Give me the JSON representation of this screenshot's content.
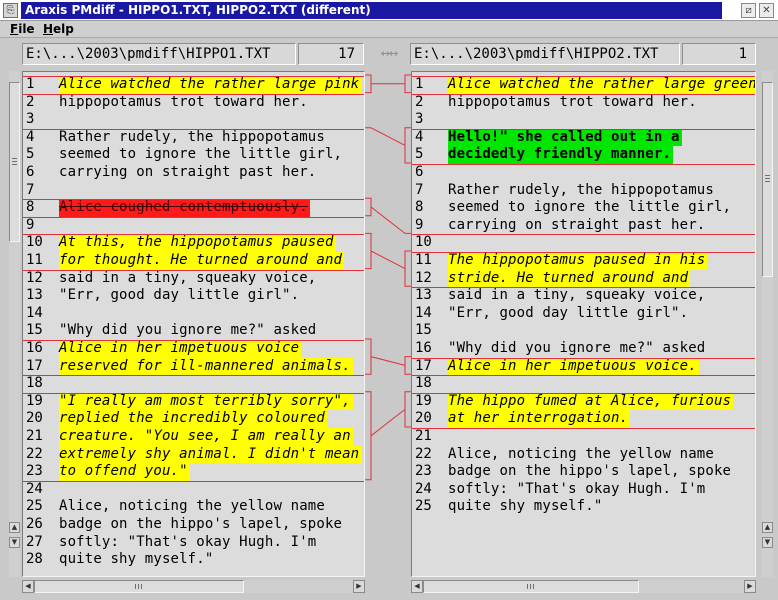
{
  "window": {
    "title": "Araxis PMdiff - HIPPO1.TXT, HIPPO2.TXT (different)",
    "app_icon": "app-icon",
    "buttons": [
      "minimize-icon",
      "close-icon"
    ]
  },
  "menu": [
    {
      "label": "File",
      "mnemonic": "F"
    },
    {
      "label": "Help",
      "mnemonic": "H"
    }
  ],
  "left": {
    "path": "E:\\...\\2003\\pmdiff\\HIPPO1.TXT",
    "count": "17",
    "lines": [
      {
        "n": "1",
        "text": "Alice watched the rather large pink",
        "kind": "changed"
      },
      {
        "n": "2",
        "text": "hippopotamus trot toward her.",
        "kind": "same"
      },
      {
        "n": "3",
        "text": "",
        "kind": "same"
      },
      {
        "n": "4",
        "text": "Rather rudely, the hippopotamus",
        "kind": "same"
      },
      {
        "n": "5",
        "text": "seemed to ignore the little girl,",
        "kind": "same"
      },
      {
        "n": "6",
        "text": "carrying on straight past her.",
        "kind": "same"
      },
      {
        "n": "7",
        "text": "",
        "kind": "same"
      },
      {
        "n": "8",
        "text": "Alice coughed contemptuously.",
        "kind": "deleted"
      },
      {
        "n": "9",
        "text": "",
        "kind": "same"
      },
      {
        "n": "10",
        "text": "At this, the hippopotamus paused",
        "kind": "changed"
      },
      {
        "n": "11",
        "text": "for thought. He turned around and",
        "kind": "changed"
      },
      {
        "n": "12",
        "text": "said in a tiny, squeaky voice,",
        "kind": "same"
      },
      {
        "n": "13",
        "text": "\"Err, good day little girl\".",
        "kind": "same"
      },
      {
        "n": "14",
        "text": "",
        "kind": "same"
      },
      {
        "n": "15",
        "text": "\"Why did you ignore me?\" asked",
        "kind": "same"
      },
      {
        "n": "16",
        "text": "Alice in her impetuous voice",
        "kind": "changed"
      },
      {
        "n": "17",
        "text": "reserved for ill-mannered animals.",
        "kind": "changed"
      },
      {
        "n": "18",
        "text": "",
        "kind": "same"
      },
      {
        "n": "19",
        "text": "\"I really am most terribly sorry\",",
        "kind": "changed"
      },
      {
        "n": "20",
        "text": "replied the incredibly coloured",
        "kind": "changed"
      },
      {
        "n": "21",
        "text": "creature. \"You see, I am really an",
        "kind": "changed"
      },
      {
        "n": "22",
        "text": "extremely shy animal. I didn't mean",
        "kind": "changed"
      },
      {
        "n": "23",
        "text": "to offend you.\"",
        "kind": "changed"
      },
      {
        "n": "24",
        "text": "",
        "kind": "same"
      },
      {
        "n": "25",
        "text": "Alice, noticing the yellow name",
        "kind": "same"
      },
      {
        "n": "26",
        "text": "badge on the hippo's lapel, spoke",
        "kind": "same"
      },
      {
        "n": "27",
        "text": "softly: \"That's okay Hugh. I'm",
        "kind": "same"
      },
      {
        "n": "28",
        "text": "quite shy myself.\"",
        "kind": "same"
      }
    ]
  },
  "right": {
    "path": "E:\\...\\2003\\pmdiff\\HIPPO2.TXT",
    "count": "1",
    "lines": [
      {
        "n": "1",
        "text": "Alice watched the rather large green",
        "kind": "changed"
      },
      {
        "n": "2",
        "text": "hippopotamus trot toward her.",
        "kind": "same"
      },
      {
        "n": "3",
        "text": "",
        "kind": "same"
      },
      {
        "n": "4",
        "text": "Hello!\" she called out in a",
        "kind": "inserted"
      },
      {
        "n": "5",
        "text": "decidedly friendly manner.",
        "kind": "inserted"
      },
      {
        "n": "6",
        "text": "",
        "kind": "same"
      },
      {
        "n": "7",
        "text": "Rather rudely, the hippopotamus",
        "kind": "same"
      },
      {
        "n": "8",
        "text": "seemed to ignore the little girl,",
        "kind": "same"
      },
      {
        "n": "9",
        "text": "carrying on straight past her.",
        "kind": "same"
      },
      {
        "n": "10",
        "text": "",
        "kind": "same"
      },
      {
        "n": "11",
        "text": "The hippopotamus paused in his",
        "kind": "changed"
      },
      {
        "n": "12",
        "text": "stride. He turned around and",
        "kind": "changed"
      },
      {
        "n": "13",
        "text": "said in a tiny, squeaky voice,",
        "kind": "same"
      },
      {
        "n": "14",
        "text": "\"Err, good day little girl\".",
        "kind": "same"
      },
      {
        "n": "15",
        "text": "",
        "kind": "same"
      },
      {
        "n": "16",
        "text": "\"Why did you ignore me?\" asked",
        "kind": "same"
      },
      {
        "n": "17",
        "text": "Alice in her impetuous voice.",
        "kind": "changed"
      },
      {
        "n": "18",
        "text": "",
        "kind": "same"
      },
      {
        "n": "19",
        "text": "The hippo fumed at Alice, furious",
        "kind": "changed"
      },
      {
        "n": "20",
        "text": "at her interrogation.",
        "kind": "changed"
      },
      {
        "n": "21",
        "text": "",
        "kind": "same"
      },
      {
        "n": "22",
        "text": "Alice, noticing the yellow name",
        "kind": "same"
      },
      {
        "n": "23",
        "text": "badge on the hippo's lapel, spoke",
        "kind": "same"
      },
      {
        "n": "24",
        "text": "softly: \"That's okay Hugh. I'm",
        "kind": "same"
      },
      {
        "n": "25",
        "text": "quite shy myself.\"",
        "kind": "same"
      }
    ]
  },
  "links": [
    {
      "l": [
        1,
        1
      ],
      "r": [
        1,
        1
      ],
      "kind": "changed"
    },
    {
      "l": [
        4,
        3
      ],
      "r": [
        4,
        5
      ],
      "kind": "inserted"
    },
    {
      "l": [
        8,
        8
      ],
      "r": [
        10,
        9
      ],
      "kind": "deleted"
    },
    {
      "l": [
        10,
        11
      ],
      "r": [
        11,
        12
      ],
      "kind": "changed"
    },
    {
      "l": [
        16,
        17
      ],
      "r": [
        17,
        17
      ],
      "kind": "changed"
    },
    {
      "l": [
        19,
        23
      ],
      "r": [
        19,
        20
      ],
      "kind": "changed"
    }
  ],
  "colors": {
    "changed": "#ffff00",
    "inserted": "#00e600",
    "deleted": "#ff1a1a",
    "link_line": "#e0303a",
    "title_bar": "#1818a2"
  },
  "icons": {
    "swap": "swap-arrows-icon",
    "scroll_up": "arrow-up-icon",
    "scroll_down": "arrow-down-icon",
    "scroll_left": "arrow-left-icon",
    "scroll_right": "arrow-right-icon"
  }
}
